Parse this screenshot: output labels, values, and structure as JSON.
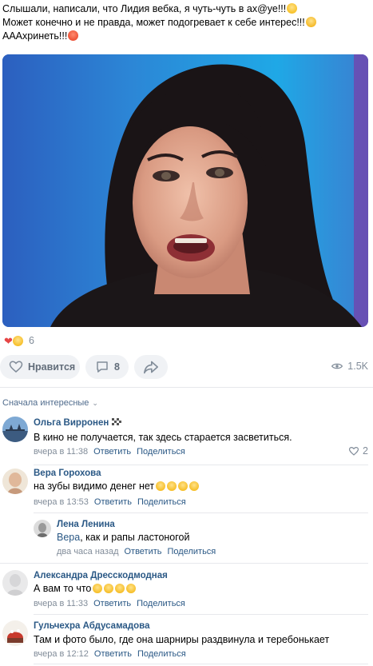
{
  "post": {
    "text_lines": [
      "Слышали, написали, что Лидия вебка, я чуть-чуть в ах@уе!!!",
      "Может конечно и не правда, может подогревает к себе интерес!!!",
      "АААхринеть!!!"
    ],
    "line_emojis": [
      "scream",
      "angry",
      "rage"
    ]
  },
  "reactions": {
    "count": "6",
    "icons": [
      "heart-icon",
      "laugh-emoji-icon"
    ]
  },
  "actions": {
    "like_label": "Нравится",
    "comments_count": "8",
    "views": "1.5K"
  },
  "comments_sort": {
    "label": "Сначала интересные"
  },
  "comments": [
    {
      "author": "Ольга Вирронен",
      "text": "В кино не получается, так здесь старается засветиться.",
      "time": "вчера в 11:38",
      "reply_label": "Ответить",
      "share_label": "Поделиться",
      "likes": "2",
      "author_badge": "checkered-flag-icon"
    },
    {
      "author": "Вера Горохова",
      "text": "на зубы видимо денег нет",
      "emoji_count": 4,
      "time": "вчера в 13:53",
      "reply_label": "Ответить",
      "share_label": "Поделиться"
    },
    {
      "author": "Лена Ленина",
      "text": "Вера, как и рапы ластоногой",
      "time": "два часа назад",
      "reply_label": "Ответить",
      "share_label": "Поделиться",
      "is_reply": true
    },
    {
      "author": "Александра Дресскодмодная",
      "text": "А вам то что",
      "emoji_count": 4,
      "time": "вчера в 11:33",
      "reply_label": "Ответить",
      "share_label": "Поделиться"
    },
    {
      "author": "Гульчехра Абдусамадова",
      "text": "Там и фото было, где она шарниры раздвинула и теребонькает",
      "time": "вчера в 12:12",
      "reply_label": "Ответить",
      "share_label": "Поделиться"
    }
  ],
  "colors": {
    "link": "#2a5885",
    "meta": "#818c99",
    "pill_bg": "#f0f2f5",
    "heart": "#e64646"
  }
}
